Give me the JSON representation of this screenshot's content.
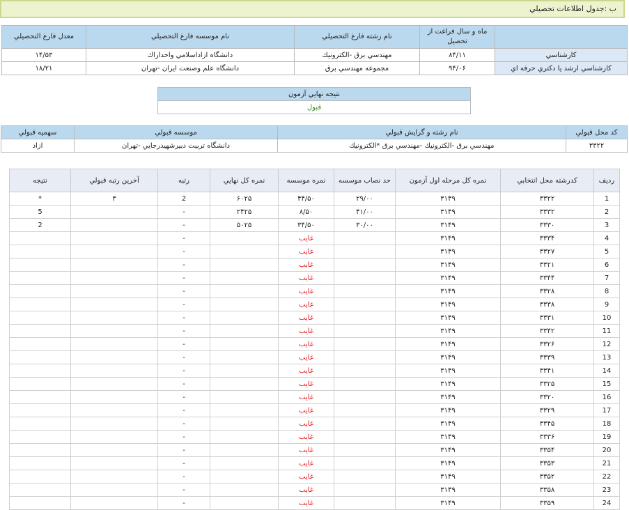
{
  "section_title": "ب :جدول اطلاعات تحصيلي",
  "education": {
    "headers": [
      "",
      "ماه و سال فراغت از تحصيل",
      "نام رشته فارغ التحصيلي",
      "نام موسسه فارغ التحصيلي",
      "معدل فارغ التحصيلي"
    ],
    "rows": [
      [
        "كارشناسي",
        "۸۴/۱۱",
        "مهندسي برق -الكترونيك",
        "دانشگاه ازاداسلامي واحداراك",
        "۱۴/۵۳"
      ],
      [
        "كارشناسي ارشد يا دكتري حرفه اي",
        "۹۴/۰۶",
        "مجموعه مهندسي برق",
        "دانشگاه علم وصنعت ايران -تهران",
        "۱۸/۲۱"
      ]
    ]
  },
  "final_result": {
    "header": "نتيجه نهايي آزمون",
    "value": "قبول"
  },
  "admission": {
    "headers": [
      "كد محل قبولي",
      "نام رشته و گرايش قبولي",
      "موسسه قبولي",
      "سهميه قبولي"
    ],
    "row": [
      "۳۳۲۲",
      "مهندسي برق -الكترونيك -مهندسي برق *الكترونيك",
      "دانشگاه تربيت دبيرشهيدرجايي -تهران",
      "ازاد"
    ]
  },
  "choices": {
    "headers": [
      "رديف",
      "كدرشته محل انتخابي",
      "نمره كل مرحله اول آزمون",
      "حد نصاب موسسه",
      "نمره موسسه",
      "نمره كل نهايي",
      "رتبه",
      "آخرين رتبه قبولي",
      "نتيجه"
    ],
    "rows": [
      [
        "1",
        "۳۳۲۲",
        "۳۱۴۹",
        "۲۹/۰۰",
        "۴۴/۵۰",
        "۶۰۲۵",
        "2",
        "۳",
        "*"
      ],
      [
        "2",
        "۳۳۳۲",
        "۳۱۴۹",
        "۴۱/۰۰",
        "۸/۵۰",
        "۲۴۲۵",
        "-",
        "",
        "5"
      ],
      [
        "3",
        "۳۳۳۰",
        "۳۱۴۹",
        "۳۰/۰۰",
        "۳۴/۵۰",
        "۵۰۲۵",
        "-",
        "",
        "2"
      ],
      [
        "4",
        "۳۳۳۴",
        "۳۱۴۹",
        "",
        "غايب",
        "",
        "-",
        "",
        ""
      ],
      [
        "5",
        "۳۳۲۷",
        "۳۱۴۹",
        "",
        "غايب",
        "",
        "-",
        "",
        ""
      ],
      [
        "6",
        "۳۳۲۱",
        "۳۱۴۹",
        "",
        "غايب",
        "",
        "-",
        "",
        ""
      ],
      [
        "7",
        "۳۳۴۴",
        "۳۱۴۹",
        "",
        "غايب",
        "",
        "-",
        "",
        ""
      ],
      [
        "8",
        "۳۳۲۸",
        "۳۱۴۹",
        "",
        "غايب",
        "",
        "-",
        "",
        ""
      ],
      [
        "9",
        "۳۳۳۸",
        "۳۱۴۹",
        "",
        "غايب",
        "",
        "-",
        "",
        ""
      ],
      [
        "10",
        "۳۳۳۱",
        "۳۱۴۹",
        "",
        "غايب",
        "",
        "-",
        "",
        ""
      ],
      [
        "11",
        "۳۳۴۲",
        "۳۱۴۹",
        "",
        "غايب",
        "",
        "-",
        "",
        ""
      ],
      [
        "12",
        "۳۳۲۶",
        "۳۱۴۹",
        "",
        "غايب",
        "",
        "-",
        "",
        ""
      ],
      [
        "13",
        "۳۳۳۹",
        "۳۱۴۹",
        "",
        "غايب",
        "",
        "-",
        "",
        ""
      ],
      [
        "14",
        "۳۳۴۱",
        "۳۱۴۹",
        "",
        "غايب",
        "",
        "-",
        "",
        ""
      ],
      [
        "15",
        "۳۳۲۵",
        "۳۱۴۹",
        "",
        "غايب",
        "",
        "-",
        "",
        ""
      ],
      [
        "16",
        "۳۳۲۰",
        "۳۱۴۹",
        "",
        "غايب",
        "",
        "-",
        "",
        ""
      ],
      [
        "17",
        "۳۳۲۹",
        "۳۱۴۹",
        "",
        "غايب",
        "",
        "-",
        "",
        ""
      ],
      [
        "18",
        "۳۳۴۵",
        "۳۱۴۹",
        "",
        "غايب",
        "",
        "-",
        "",
        ""
      ],
      [
        "19",
        "۳۳۳۶",
        "۳۱۴۹",
        "",
        "غايب",
        "",
        "-",
        "",
        ""
      ],
      [
        "20",
        "۳۳۵۴",
        "۳۱۴۹",
        "",
        "غايب",
        "",
        "-",
        "",
        ""
      ],
      [
        "21",
        "۳۳۵۳",
        "۳۱۴۹",
        "",
        "غايب",
        "",
        "-",
        "",
        ""
      ],
      [
        "22",
        "۳۳۵۲",
        "۳۱۴۹",
        "",
        "غايب",
        "",
        "-",
        "",
        ""
      ],
      [
        "23",
        "۳۳۵۸",
        "۳۱۴۹",
        "",
        "غايب",
        "",
        "-",
        "",
        ""
      ],
      [
        "24",
        "۳۳۵۹",
        "۳۱۴۹",
        "",
        "غايب",
        "",
        "-",
        "",
        ""
      ]
    ]
  },
  "colors": {
    "section_bar_bg": "#edf3cf",
    "header_blue": "#bbd9ee",
    "accepted_green": "#3c8b1c",
    "absent_red": "#e0161b"
  }
}
